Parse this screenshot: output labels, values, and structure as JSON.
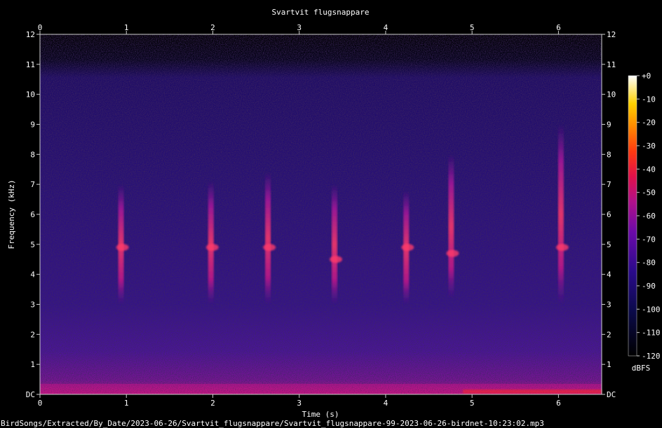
{
  "chart_data": {
    "type": "heatmap",
    "title": "Svartvit flugsnappare",
    "xlabel": "Time (s)",
    "ylabel": "Frequency (kHz)",
    "xlim": [
      0,
      6.5
    ],
    "ylim": [
      0,
      12
    ],
    "x_ticks": [
      "0",
      "1",
      "2",
      "3",
      "4",
      "5",
      "6"
    ],
    "y_ticks": [
      "DC",
      "1",
      "2",
      "3",
      "4",
      "5",
      "6",
      "7",
      "8",
      "9",
      "10",
      "11",
      "12"
    ],
    "colorbar": {
      "label": "dBFS",
      "ticks": [
        "+0",
        "-10",
        "-20",
        "-30",
        "-40",
        "-50",
        "-60",
        "-70",
        "-80",
        "-90",
        "-100",
        "-110",
        "-120"
      ],
      "range": [
        -120,
        0
      ]
    },
    "song_elements": [
      {
        "t": 0.93,
        "f_low": 3.0,
        "f_high": 7.0,
        "peak_f": 4.9
      },
      {
        "t": 1.97,
        "f_low": 3.0,
        "f_high": 7.1,
        "peak_f": 4.9
      },
      {
        "t": 2.63,
        "f_low": 3.0,
        "f_high": 7.4,
        "peak_f": 4.9
      },
      {
        "t": 3.4,
        "f_low": 3.0,
        "f_high": 7.0,
        "peak_f": 4.5
      },
      {
        "t": 4.23,
        "f_low": 3.0,
        "f_high": 6.8,
        "peak_f": 4.9
      },
      {
        "t": 4.75,
        "f_low": 3.2,
        "f_high": 8.0,
        "peak_f": 4.7
      },
      {
        "t": 6.02,
        "f_low": 3.0,
        "f_high": 9.0,
        "peak_f": 4.9
      }
    ]
  },
  "footer": {
    "path": "BirdSongs/Extracted/By_Date/2023-06-26/Svartvit_flugsnappare/Svartvit_flugsnappare-99-2023-06-26-birdnet-10:23:02.mp3"
  }
}
